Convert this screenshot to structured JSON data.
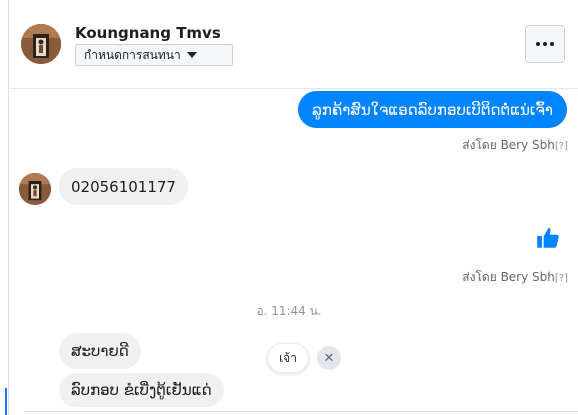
{
  "header": {
    "contact_name": "Koungnang Tmvs",
    "conversation_button_label": "กำหนดการสนทนา",
    "more_icon": "ellipsis-icon"
  },
  "messages": {
    "outgoing_1": {
      "text": "ລູກຄ້າສົນໃຈແອດລົບກອບເບີຕິດຕໍ່ແນ່ເຈົ້າ",
      "sent_by": "ส่งโดย Bery Sbh",
      "help_mark": "[?]"
    },
    "incoming_1": {
      "text": "02056101177"
    },
    "outgoing_like": {
      "icon": "thumbs-up-icon",
      "color": "#0084ff",
      "sent_by": "ส่งโดย Bery Sbh",
      "help_mark": "[?]"
    },
    "timestamp": "อ. 11:44 น.",
    "incoming_2": {
      "text": "ສະບາຍດີ"
    },
    "incoming_3": {
      "text": "ລົບກອບ ຂໍເບີ່ງຕູ້ເຢັນແດ່"
    }
  },
  "quick_reply": {
    "chip_label": "เจ้า",
    "close_icon": "close-icon",
    "close_glyph": "✕"
  },
  "colors": {
    "accent": "#0084ff",
    "incoming_bubble": "#f1f0f0"
  }
}
